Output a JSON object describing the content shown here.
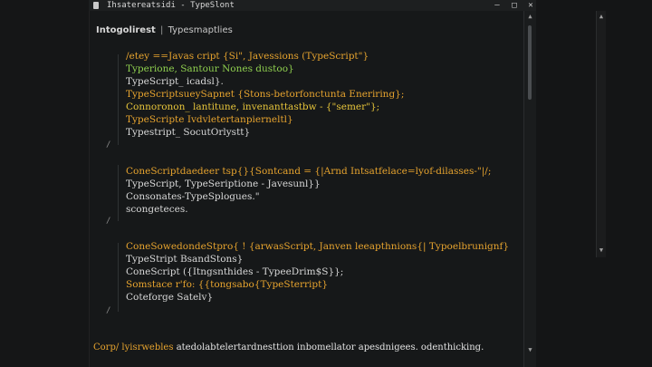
{
  "window": {
    "title": "Ihsatereatsidi - TypeSlont",
    "controls": {
      "minimize": "—",
      "maximize": "□",
      "close": "✕"
    }
  },
  "breadcrumb": {
    "root": "Intogolirest",
    "separator": "|",
    "item": "Typesmaptlies"
  },
  "gutter_markers": [
    "/",
    "/",
    "/"
  ],
  "code_blocks": [
    {
      "lines": [
        {
          "text": "/etey ==Javas cript {Si\", Javessions (TypeScript\"}",
          "color": "#e6a32e"
        },
        {
          "text": "Typerione, Santour Nones dustoo}",
          "color": "#8fcf4f"
        },
        {
          "text": "TypeScript_ icadsl}.",
          "color": "#d8d8d8"
        },
        {
          "text": "TypeScriptsueySapnet {Stons-betorfonctunta Eneriring};",
          "color": "#e6a32e"
        },
        {
          "text": "Connoronon_ lantitune, invenanttastbw - {\"semer\"};",
          "color": "#e6c43a"
        },
        {
          "text": "TypeScripte Ivdvletertanpierneltl}",
          "color": "#e6a32e"
        },
        {
          "text": "Typestript_ SocutOrlystt}",
          "color": "#d8d8d8"
        }
      ]
    },
    {
      "lines": [
        {
          "text": "ConeScriptdaedeer tsp{}{Sontcand = {|Arnd Intsatfelace=lyof-dilasses-\"|/;",
          "color": "#e6a32e"
        },
        {
          "text": "TypeScript, TypeSeriptione - Javesunl}}",
          "color": "#d8d8d8"
        },
        {
          "text": "Consonates-TypeSplogues.\"",
          "color": "#d8d8d8"
        },
        {
          "text": "scongeteces.",
          "color": "#d8d8d8"
        }
      ]
    },
    {
      "lines": [
        {
          "text": "ConeSowedondeStpro{ ! {arwasScript, Janven leeapthnions{| Typoelbrunignf}",
          "color": "#e6a32e"
        },
        {
          "text": "TypeStript BsandStons}",
          "color": "#d8d8d8"
        },
        {
          "text": "ConeScript ({Itngsnthides - TypeeDrim$S}};",
          "color": "#d8d8d8"
        },
        {
          "text": "Somstace r'fo: {{tongsabo{TypeSterript}",
          "color": "#e6a32e"
        },
        {
          "text": "Coteforge Satelv}",
          "color": "#d8d8d8"
        }
      ]
    }
  ],
  "status": {
    "left": "Corp/ lyisrwebles",
    "right": "atedolabtelertardnesttion inbomellator apesdnigees. odenthicking."
  },
  "scroll_arrows": {
    "up": "▲",
    "down": "▼"
  },
  "colors": {
    "keyword": "#e6a32e",
    "type": "#8fcf4f",
    "plain": "#d8d8d8",
    "background": "#161819"
  }
}
